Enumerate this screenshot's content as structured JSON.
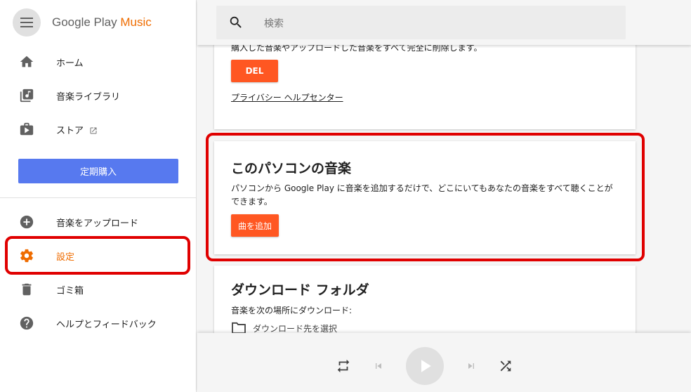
{
  "app": {
    "logo_main": "Google Play",
    "logo_accent": "Music"
  },
  "search": {
    "placeholder": "検索"
  },
  "sidebar": {
    "items": [
      {
        "label": "ホーム",
        "icon": "home-icon"
      },
      {
        "label": "音楽ライブラリ",
        "icon": "library-music-icon"
      },
      {
        "label": "ストア",
        "icon": "store-icon"
      },
      {
        "label": "音楽をアップロード",
        "icon": "add-circle-icon"
      },
      {
        "label": "設定",
        "icon": "gear-icon",
        "active": true
      },
      {
        "label": "ゴミ箱",
        "icon": "trash-icon"
      },
      {
        "label": "ヘルプとフィードバック",
        "icon": "help-icon"
      }
    ],
    "subscribe_label": "定期購入"
  },
  "cards": {
    "delete": {
      "description": "購入した音楽やアップロードした音楽をすべて完全に削除します。",
      "button_label": "DEL",
      "link_label": "プライバシー ヘルプセンター"
    },
    "pc_music": {
      "title": "このパソコンの音楽",
      "description": "パソコンから Google Play に音楽を追加するだけで、どこにいてもあなたの音楽をすべて聴くことができます。",
      "button_label": "曲を追加"
    },
    "download_folder": {
      "title": "ダウンロード フォルダ",
      "description": "音楽を次の場所にダウンロード:",
      "folder_label": "ダウンロード先を選択"
    }
  },
  "player": {
    "controls": [
      "repeat-icon",
      "skip-previous-icon",
      "play-icon",
      "skip-next-icon",
      "shuffle-icon"
    ]
  },
  "colors": {
    "accent": "#ef6c00",
    "action_button": "#ff5722",
    "subscribe_button": "#5779ef",
    "highlight": "#e00000"
  }
}
